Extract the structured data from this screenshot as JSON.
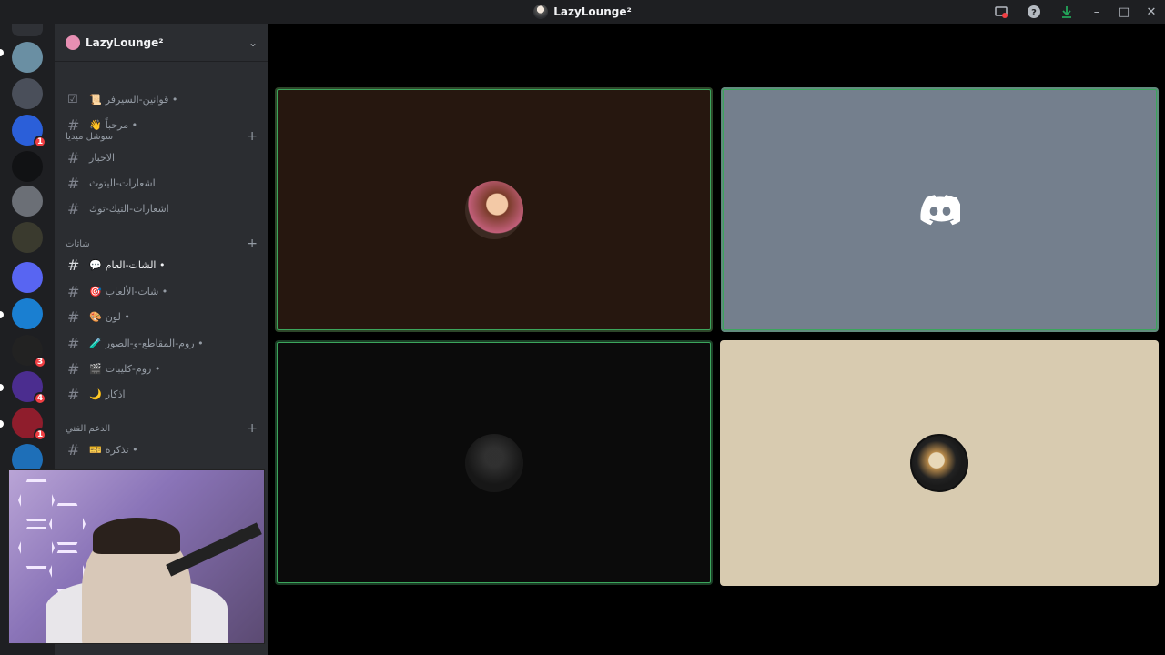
{
  "window": {
    "title": "LazyLounge²"
  },
  "titlebar_icons": [
    "screen-share-icon",
    "help-icon",
    "download-icon",
    "minimize-icon",
    "maximize-icon",
    "close-icon"
  ],
  "server": {
    "name": "LazyLounge²"
  },
  "channels_top": [
    {
      "name": "قوانين-السيرفر •",
      "emoji": "📜",
      "type": "rules"
    },
    {
      "name": "مرحباً •",
      "emoji": "👋",
      "type": "text"
    }
  ],
  "categories": [
    {
      "label": "سوشل ميديا",
      "channels": [
        {
          "name": "الاخبار"
        },
        {
          "name": "اشعارات-اليتوث"
        },
        {
          "name": "اشعارات-التيك-توك"
        }
      ]
    },
    {
      "label": "شاتات",
      "channels": [
        {
          "name": "الشات-العام •",
          "emoji": "💬",
          "active": true
        },
        {
          "name": "شات-الألعاب •",
          "emoji": "🎯"
        },
        {
          "name": "لون •",
          "emoji": "🎨"
        },
        {
          "name": "روم-المقاطع-و-الصور •",
          "emoji": "🧪"
        },
        {
          "name": "روم-كليبات •",
          "emoji": "🎬"
        },
        {
          "name": "اذكار",
          "emoji": "🌙"
        }
      ]
    },
    {
      "label": "الدعم الفني",
      "channels": [
        {
          "name": "تذكرة •",
          "emoji": "🎫"
        }
      ]
    }
  ],
  "servers": [
    {
      "color": "#2f3136",
      "badge": ""
    },
    {
      "color": "#6a8fa3",
      "badge": ""
    },
    {
      "color": "#4a4f5a",
      "badge": ""
    },
    {
      "color": "#2b5fd9",
      "badge": "1"
    },
    {
      "color": "#111214",
      "badge": ""
    },
    {
      "color": "#6b6f76",
      "badge": ""
    },
    {
      "color": "#3a3a2e",
      "badge": ""
    },
    {
      "color": "#5865f2",
      "badge": ""
    },
    {
      "color": "#1a7fd1",
      "badge": ""
    },
    {
      "color": "#222",
      "badge": "3"
    },
    {
      "color": "#4b2d8f",
      "badge": "4"
    },
    {
      "color": "#8f1d2c",
      "badge": "1"
    },
    {
      "color": "#1e6fb8",
      "badge": ""
    }
  ],
  "colors": {
    "accent": "#5865f2",
    "speaking": "#3ba55c",
    "tile1": "#26170f",
    "tile2": "#747f8d",
    "tile3": "#0b0b0b",
    "tile4": "#d8cbb0"
  }
}
